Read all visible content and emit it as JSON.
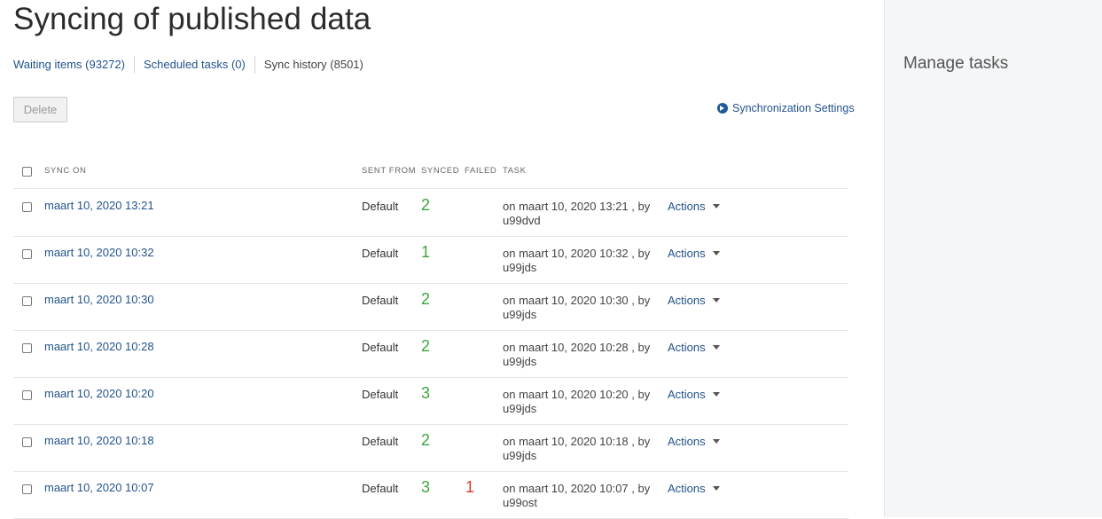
{
  "page": {
    "title": "Syncing of published data"
  },
  "tabs": [
    {
      "label": "Waiting items (93272)"
    },
    {
      "label": "Scheduled tasks (0)"
    },
    {
      "label": "Sync history (8501)"
    }
  ],
  "toolbar": {
    "delete_label": "Delete",
    "settings_label": "Synchronization Settings"
  },
  "table": {
    "headers": {
      "sync_on": "SYNC ON",
      "sent_from": "SENT FROM",
      "synced": "SYNCED",
      "failed": "FAILED",
      "task": "TASK"
    },
    "rows": [
      {
        "date": "maart 10, 2020 13:21",
        "sent_from": "Default",
        "synced": "2",
        "failed": "",
        "task_line1": "on maart 10, 2020 13:21 , by",
        "task_line2": "u99dvd",
        "actions": "Actions"
      },
      {
        "date": "maart 10, 2020 10:32",
        "sent_from": "Default",
        "synced": "1",
        "failed": "",
        "task_line1": "on maart 10, 2020 10:32 , by",
        "task_line2": "u99jds",
        "actions": "Actions"
      },
      {
        "date": "maart 10, 2020 10:30",
        "sent_from": "Default",
        "synced": "2",
        "failed": "",
        "task_line1": "on maart 10, 2020 10:30 , by",
        "task_line2": "u99jds",
        "actions": "Actions"
      },
      {
        "date": "maart 10, 2020 10:28",
        "sent_from": "Default",
        "synced": "2",
        "failed": "",
        "task_line1": "on maart 10, 2020 10:28 , by",
        "task_line2": "u99jds",
        "actions": "Actions"
      },
      {
        "date": "maart 10, 2020 10:20",
        "sent_from": "Default",
        "synced": "3",
        "failed": "",
        "task_line1": "on maart 10, 2020 10:20 , by",
        "task_line2": "u99jds",
        "actions": "Actions"
      },
      {
        "date": "maart 10, 2020 10:18",
        "sent_from": "Default",
        "synced": "2",
        "failed": "",
        "task_line1": "on maart 10, 2020 10:18 , by",
        "task_line2": "u99jds",
        "actions": "Actions"
      },
      {
        "date": "maart 10, 2020 10:07",
        "sent_from": "Default",
        "synced": "3",
        "failed": "1",
        "task_line1": "on maart 10, 2020 10:07 , by",
        "task_line2": "u99ost",
        "actions": "Actions"
      }
    ]
  },
  "sidebar": {
    "title": "Manage tasks"
  },
  "colors": {
    "link": "#22538c",
    "synced": "#3ea53e",
    "failed": "#d93b2b",
    "sidebar_bg": "#f5f6f8"
  }
}
